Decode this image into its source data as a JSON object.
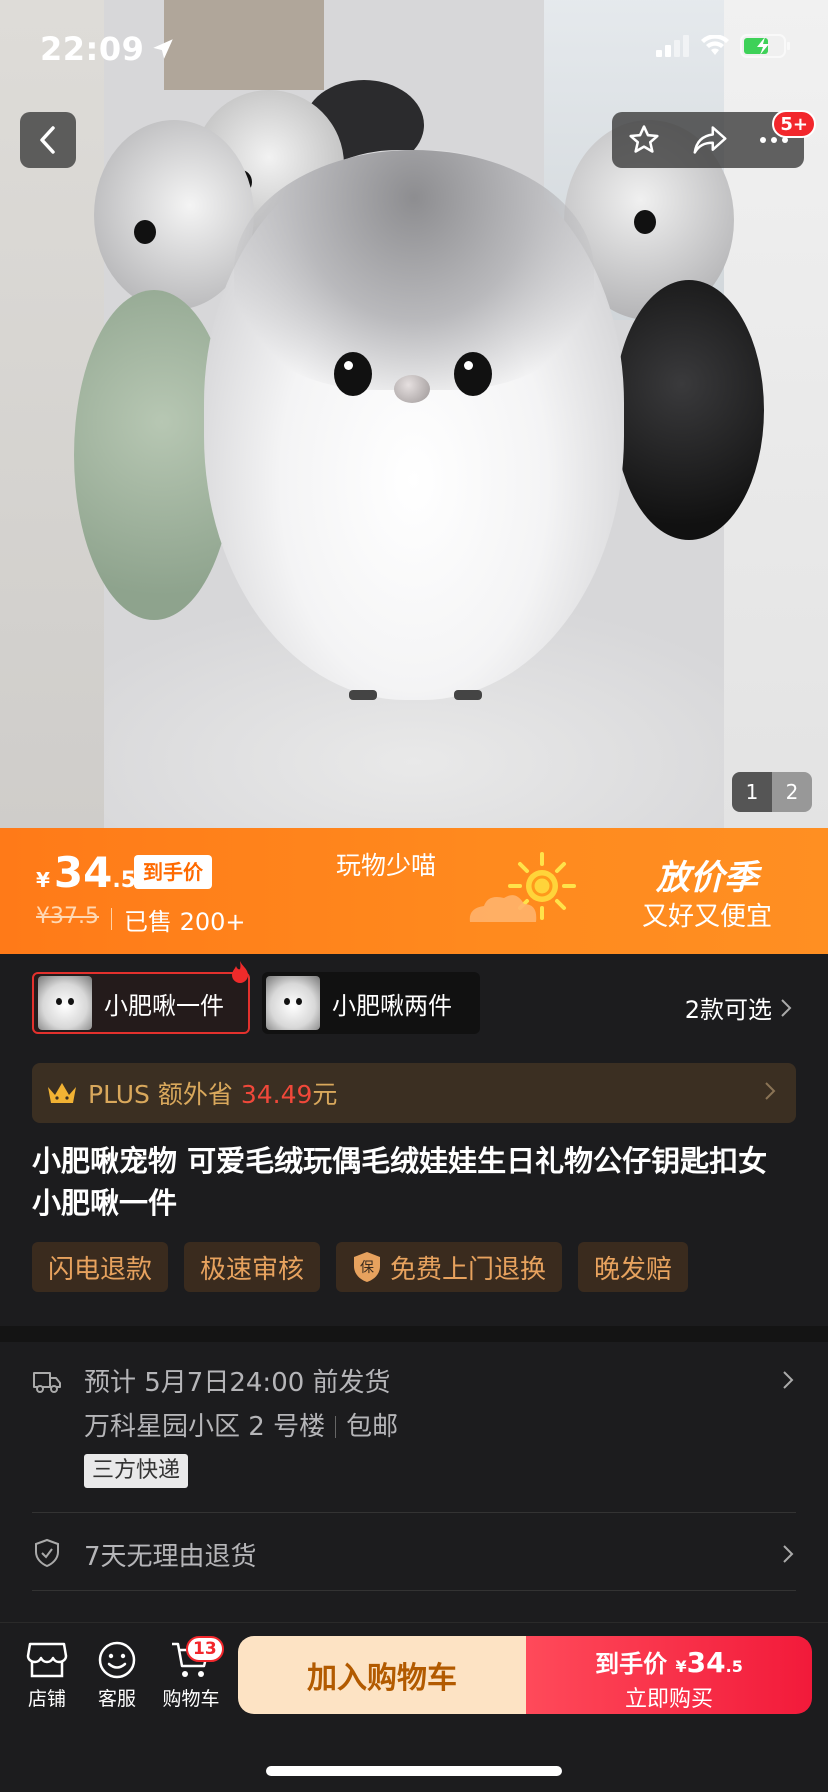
{
  "status_bar": {
    "time": "22:09"
  },
  "top": {
    "notification_badge": "5+"
  },
  "gallery": {
    "pages": [
      "1",
      "2"
    ],
    "current": 1
  },
  "banner": {
    "currency": "¥",
    "price_int": "34",
    "price_dec": ".5",
    "final_price_tag": "到手价",
    "original_price": "¥37.5",
    "sold": "已售 200+",
    "shop_name": "玩物少喵",
    "promo_title": "放价季",
    "promo_subtitle": "又好又便宜"
  },
  "variants": {
    "items": [
      {
        "label": "小肥啾一件",
        "selected": true
      },
      {
        "label": "小肥啾两件",
        "selected": false
      }
    ],
    "count_label": "2款可选"
  },
  "plus": {
    "prefix": "PLUS 额外省 ",
    "amount": "34.49",
    "suffix": "元"
  },
  "product": {
    "title": "小肥啾宠物 可爱毛绒玩偶毛绒娃娃生日礼物公仔钥匙扣女 小肥啾一件"
  },
  "service_tags": [
    "闪电退款",
    "极速审核",
    "免费上门退换",
    "晚发赔"
  ],
  "shipping": {
    "estimate": "预计 5月7日24:00 前发货",
    "address": "万科星园小区 2 号楼",
    "shipping_fee": "包邮",
    "express": "三方快递"
  },
  "returns": {
    "label": "7天无理由退货"
  },
  "bottom_nav": {
    "store": "店铺",
    "service": "客服",
    "cart": "购物车",
    "cart_count": "13",
    "add_to_cart": "加入购物车",
    "buy_label": "到手价",
    "buy_currency": "¥",
    "buy_price_int": "34",
    "buy_price_dec": ".5",
    "buy_now": "立即购买"
  },
  "colors": {
    "accent_orange": "#ff7a18",
    "buy_red": "#f21a3a",
    "plus_gold": "#d9a85c",
    "tag_text": "#e7a25e"
  }
}
